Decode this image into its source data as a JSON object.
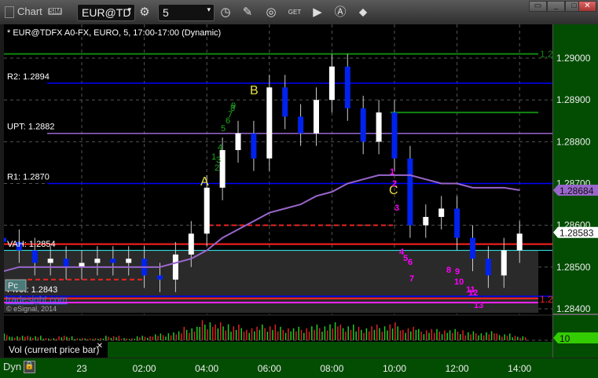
{
  "window": {
    "title": "Chart",
    "sim_badge": "SIM",
    "symbol": "EUR@TD",
    "interval": "5"
  },
  "toolbar_icons": [
    "settings-gear-icon",
    "clock-icon",
    "pencil-icon",
    "cursor-circle-icon",
    "get-icon",
    "play-icon",
    "auto-scale-icon",
    "link-icon"
  ],
  "chart_title": "* EUR@TDFX A0-FX, EURO, 5, 17:00-17:00 (Dynamic)",
  "levels": [
    {
      "label": "R2: 1.2894",
      "value": 1.2894,
      "color": "#0000ff"
    },
    {
      "label": "UPT: 1.2882",
      "value": 1.2882,
      "color": "#9966cc"
    },
    {
      "label": "R1: 1.2870",
      "value": 1.287,
      "color": "#0000ff"
    },
    {
      "label": "Pivot: 1.2843",
      "value": 1.2843,
      "color": "#0000ff"
    }
  ],
  "overlay_text": {
    "vah": "VAH: 1.2854",
    "pane_label": "Pc",
    "brand": "tradesight.com",
    "copyright": "© eSignal, 2014",
    "green_cut": "1.2",
    "red_cut": "1.2"
  },
  "pattern_labels": [
    "A",
    "B",
    "C"
  ],
  "count_labels": [
    "1",
    "2",
    "3",
    "4",
    "5",
    "6",
    "7",
    "8",
    "9",
    "10",
    "11",
    "12",
    "13"
  ],
  "green_count_labels": [
    "1",
    "2",
    "3",
    "4",
    "5",
    "6",
    "7",
    "8",
    "9"
  ],
  "colors": {
    "up": "#ffffff",
    "down": "#0022ee",
    "ma": "#9966cc",
    "axis_bg": "#034d03",
    "magenta": "#ff00ff",
    "labels_yellow": "#e8e040"
  },
  "chart_data": {
    "type": "candlestick",
    "ylim": [
      1.2838,
      1.291
    ],
    "yticks": [
      "1.29000",
      "1.28900",
      "1.28800",
      "1.28700",
      "1.28600",
      "1.28500",
      "1.28400"
    ],
    "xticks": [
      "23",
      "02:00",
      "04:00",
      "06:00",
      "08:00",
      "10:00",
      "12:00",
      "14:00"
    ],
    "last_price": "1.28583",
    "ma_last": "1.28684",
    "volume_last": "10",
    "time": [
      "21:30",
      "22:00",
      "22:30",
      "23:00",
      "23:30",
      "00:00",
      "00:30",
      "01:00",
      "01:30",
      "02:00",
      "02:30",
      "03:00",
      "03:30",
      "04:00",
      "04:30",
      "05:00",
      "05:30",
      "06:00",
      "06:30",
      "07:00",
      "07:30",
      "08:00",
      "08:30",
      "09:00",
      "09:30",
      "10:00",
      "10:30",
      "11:00",
      "11:30",
      "12:00",
      "12:30",
      "13:00",
      "13:30",
      "14:00"
    ],
    "close": [
      1.2856,
      1.2854,
      1.2851,
      1.2852,
      1.285,
      1.2851,
      1.2852,
      1.2851,
      1.2852,
      1.2848,
      1.2847,
      1.2853,
      1.2858,
      1.2869,
      1.2878,
      1.2882,
      1.2876,
      1.2893,
      1.2886,
      1.2882,
      1.289,
      1.2898,
      1.2888,
      1.288,
      1.2887,
      1.2876,
      1.286,
      1.2862,
      1.2864,
      1.2857,
      1.2852,
      1.2848,
      1.2854,
      1.2858
    ],
    "ma": [
      1.2849,
      1.285,
      1.285,
      1.285,
      1.285,
      1.285,
      1.285,
      1.285,
      1.285,
      1.285,
      1.285,
      1.2851,
      1.2852,
      1.2854,
      1.2857,
      1.2859,
      1.2861,
      1.2863,
      1.2864,
      1.2865,
      1.2867,
      1.2868,
      1.287,
      1.2871,
      1.2872,
      1.2872,
      1.2872,
      1.2871,
      1.287,
      1.287,
      1.2869,
      1.2869,
      1.2869,
      1.28684
    ],
    "volume": [
      3,
      2,
      2,
      1,
      2,
      1,
      1,
      2,
      1,
      2,
      3,
      4,
      6,
      9,
      8,
      7,
      6,
      7,
      6,
      6,
      7,
      8,
      7,
      6,
      7,
      8,
      6,
      5,
      5,
      5,
      4,
      4,
      3,
      2
    ]
  }
}
